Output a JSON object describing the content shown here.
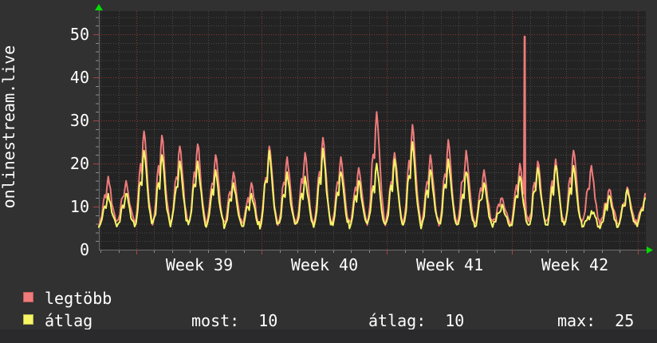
{
  "page": {
    "site_label": "onlinestream.live"
  },
  "colors": {
    "outer_bg": "#313131",
    "plot_bg": "#232323",
    "bottom_strip": "#2a2a2d",
    "text": "#ffffff",
    "grid_minor": "#4a4a4a",
    "grid_major_red": "#943636",
    "axis": "#6f6f6f",
    "tick_minor": "#8a8a8a",
    "tick_major": "#b04040",
    "arrow_green": "#00dd00",
    "series_max_pink": "#ef7b7b",
    "series_avg_yellow": "#f5f566"
  },
  "legend": {
    "series": [
      {
        "label": "legtöbb",
        "color": "#ef7b7b"
      },
      {
        "label": "átlag",
        "color": "#f5f566"
      }
    ],
    "stats": [
      {
        "label": "most:",
        "value": "10"
      },
      {
        "label": "átlag:",
        "value": "10"
      },
      {
        "label": "max:",
        "value": "25"
      }
    ]
  },
  "chart_data": {
    "type": "line",
    "title": "",
    "xlabel": "",
    "ylabel": "",
    "x_axis": {
      "labels": [
        "Week 39",
        "Week 40",
        "Week 41",
        "Week 42"
      ],
      "unit": "days",
      "days_shown": 30.56,
      "first_day_line_offset_days": 0.094,
      "week_interval_days": 7,
      "week_line_day_indices": [
        2,
        9,
        16,
        23,
        30
      ]
    },
    "y_axis": {
      "ticks": [
        0,
        10,
        20,
        30,
        40,
        50
      ],
      "tick_labels": [
        "0",
        "10",
        "20",
        "30",
        "40",
        "50"
      ],
      "minor_step": 2,
      "ylim": [
        0,
        55.4
      ],
      "grid": true
    },
    "legend_position": "bottom",
    "day_profile": [
      [
        0.0,
        0.0
      ],
      [
        0.08,
        0.06
      ],
      [
        0.17,
        0.2
      ],
      [
        0.26,
        0.52
      ],
      [
        0.33,
        0.62
      ],
      [
        0.4,
        0.56
      ],
      [
        0.46,
        0.85
      ],
      [
        0.52,
        1.0
      ],
      [
        0.58,
        0.9
      ],
      [
        0.65,
        0.7
      ],
      [
        0.72,
        0.48
      ],
      [
        0.8,
        0.27
      ],
      [
        0.88,
        0.12
      ],
      [
        0.95,
        0.04
      ]
    ],
    "series": [
      {
        "name": "legtöbb",
        "color": "#ef7b7b",
        "trough": 6.2,
        "daily_peaks": [
          17,
          16,
          27.5,
          26.5,
          24,
          24.5,
          22,
          18,
          15.5,
          24,
          21.5,
          22.5,
          26,
          21.5,
          19,
          32,
          22.5,
          29,
          22,
          25.5,
          23,
          18.5,
          12,
          20,
          20.5,
          21,
          23,
          19.5,
          14,
          14.5,
          13
        ],
        "spike": {
          "t_days": 23.79,
          "value": 49.5
        }
      },
      {
        "name": "átlag",
        "color": "#f5f566",
        "trough": 5.6,
        "daily_peaks": [
          13,
          13,
          23,
          22,
          20.5,
          20.5,
          18.5,
          15.5,
          13,
          23,
          18,
          17,
          23.5,
          18,
          16,
          20,
          21,
          25,
          18.5,
          21,
          18,
          15.5,
          10.5,
          17,
          19,
          19.5,
          19.5,
          9,
          12.5,
          14,
          12
        ]
      }
    ],
    "stats": {
      "most": 10,
      "atlag": 10,
      "max": 25
    }
  }
}
